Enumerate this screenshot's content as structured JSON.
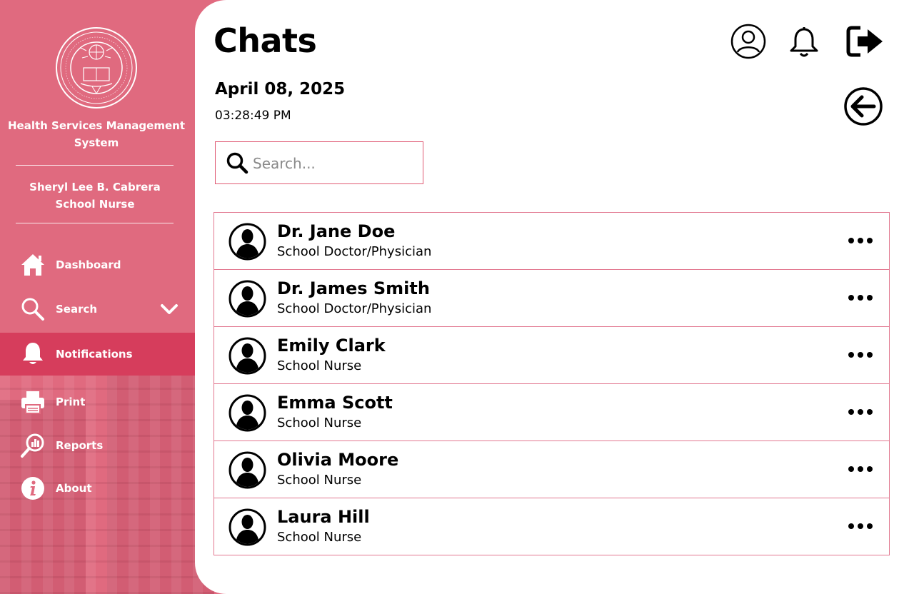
{
  "sidebar": {
    "system_title": "Health Services Management System",
    "user_name": "Sheryl Lee B. Cabrera",
    "user_role": "School Nurse",
    "items": [
      {
        "label": "Dashboard",
        "icon": "home-icon"
      },
      {
        "label": "Search",
        "icon": "search-icon"
      },
      {
        "label": "Notifications",
        "icon": "bell-icon",
        "active": true
      },
      {
        "label": "Print",
        "icon": "printer-icon"
      },
      {
        "label": "Reports",
        "icon": "reports-icon"
      },
      {
        "label": "About",
        "icon": "info-icon"
      }
    ]
  },
  "header": {
    "title": "Chats",
    "date": "April 08, 2025",
    "time": "03:28:49 PM"
  },
  "search": {
    "placeholder": "Search..."
  },
  "chats": [
    {
      "name": "Dr. Jane Doe",
      "role": "School Doctor/Physician"
    },
    {
      "name": "Dr. James Smith",
      "role": "School Doctor/Physician"
    },
    {
      "name": "Emily Clark",
      "role": "School Nurse"
    },
    {
      "name": "Emma Scott",
      "role": "School Nurse"
    },
    {
      "name": "Olivia Moore",
      "role": "School Nurse"
    },
    {
      "name": "Laura Hill",
      "role": "School Nurse"
    }
  ],
  "colors": {
    "sidebar_bg": "#e06a7f",
    "active_item": "#d63d5c",
    "row_border": "#e27890"
  }
}
